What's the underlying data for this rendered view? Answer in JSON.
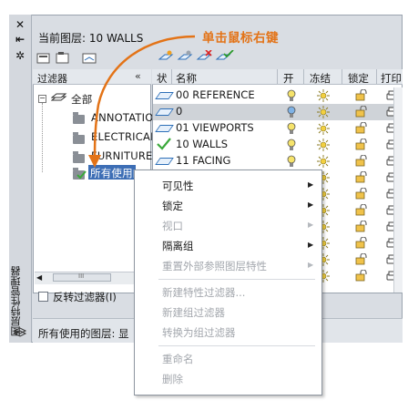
{
  "palette": {
    "title_vertical": "图层特性管理器",
    "current_layer": "当前图层: 10 WALLS",
    "filter_header": "过滤器",
    "collapse_glyph": "«",
    "tree": {
      "root": "全部",
      "items": [
        "ANNOTATIO",
        "ELECTRICAL",
        "FURNITURE",
        "所有使用的图"
      ]
    },
    "invert_filter_label": "反转过滤器(I)",
    "scroll_grip": "III",
    "status_text": "所有使用的图层: 显"
  },
  "columns": [
    "状",
    "名称",
    "开",
    "冻结",
    "锁定",
    "打印"
  ],
  "layers": [
    {
      "name": "00 REFERENCE",
      "current": false
    },
    {
      "name": "0",
      "current": false
    },
    {
      "name": "01 VIEWPORTS",
      "current": false
    },
    {
      "name": "10 WALLS",
      "current": true
    },
    {
      "name": "11 FACING",
      "current": false
    }
  ],
  "context_menu": {
    "items": [
      {
        "label": "可见性",
        "disabled": false,
        "submenu": true
      },
      {
        "label": "锁定",
        "disabled": false,
        "submenu": true
      },
      {
        "label": "视口",
        "disabled": true,
        "submenu": true
      },
      {
        "label": "隔离组",
        "disabled": false,
        "submenu": true
      },
      {
        "label": "重置外部参照图层特性",
        "disabled": true,
        "submenu": true
      },
      {
        "label": "新建特性过滤器...",
        "disabled": true,
        "submenu": false
      },
      {
        "label": "新建组过滤器",
        "disabled": true,
        "submenu": false
      },
      {
        "label": "转换为组过滤器",
        "disabled": true,
        "submenu": false
      },
      {
        "label": "重命名",
        "disabled": true,
        "submenu": false
      },
      {
        "label": "删除",
        "disabled": true,
        "submenu": false
      }
    ]
  },
  "annotation": "单击鼠标右键",
  "colors": {
    "annotation_orange": "#e37317",
    "checkmark_green": "#3aa83a",
    "layer_icon_blue": "#2d6fb8"
  }
}
